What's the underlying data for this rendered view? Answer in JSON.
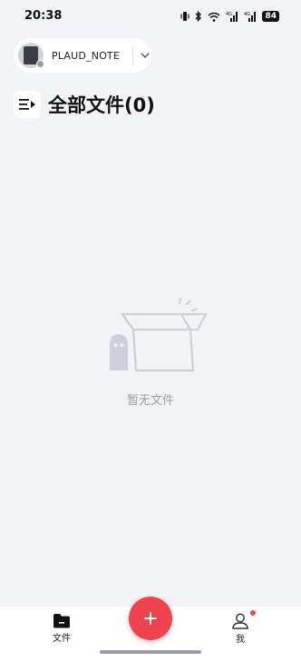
{
  "status_bar": {
    "time": "20:38",
    "battery": "84",
    "icons": [
      "vibrate-icon",
      "bluetooth-icon",
      "wifi-icon",
      "signal-4g-icon",
      "signal-4g-icon",
      "battery-icon"
    ]
  },
  "device": {
    "name": "PLAUD_NOTE",
    "icon": "chevron-down-icon"
  },
  "header": {
    "title": "全部文件(0)",
    "menu_icon": "list-expand-icon"
  },
  "empty_state": {
    "text": "暂无文件",
    "icon": "empty-box-illustration"
  },
  "tab_bar": {
    "files_label": "文件",
    "me_label": "我",
    "add_icon": "plus-icon"
  },
  "colors": {
    "background": "#f2f3f7",
    "accent": "#ef4450",
    "muted": "#9a9ca3"
  }
}
